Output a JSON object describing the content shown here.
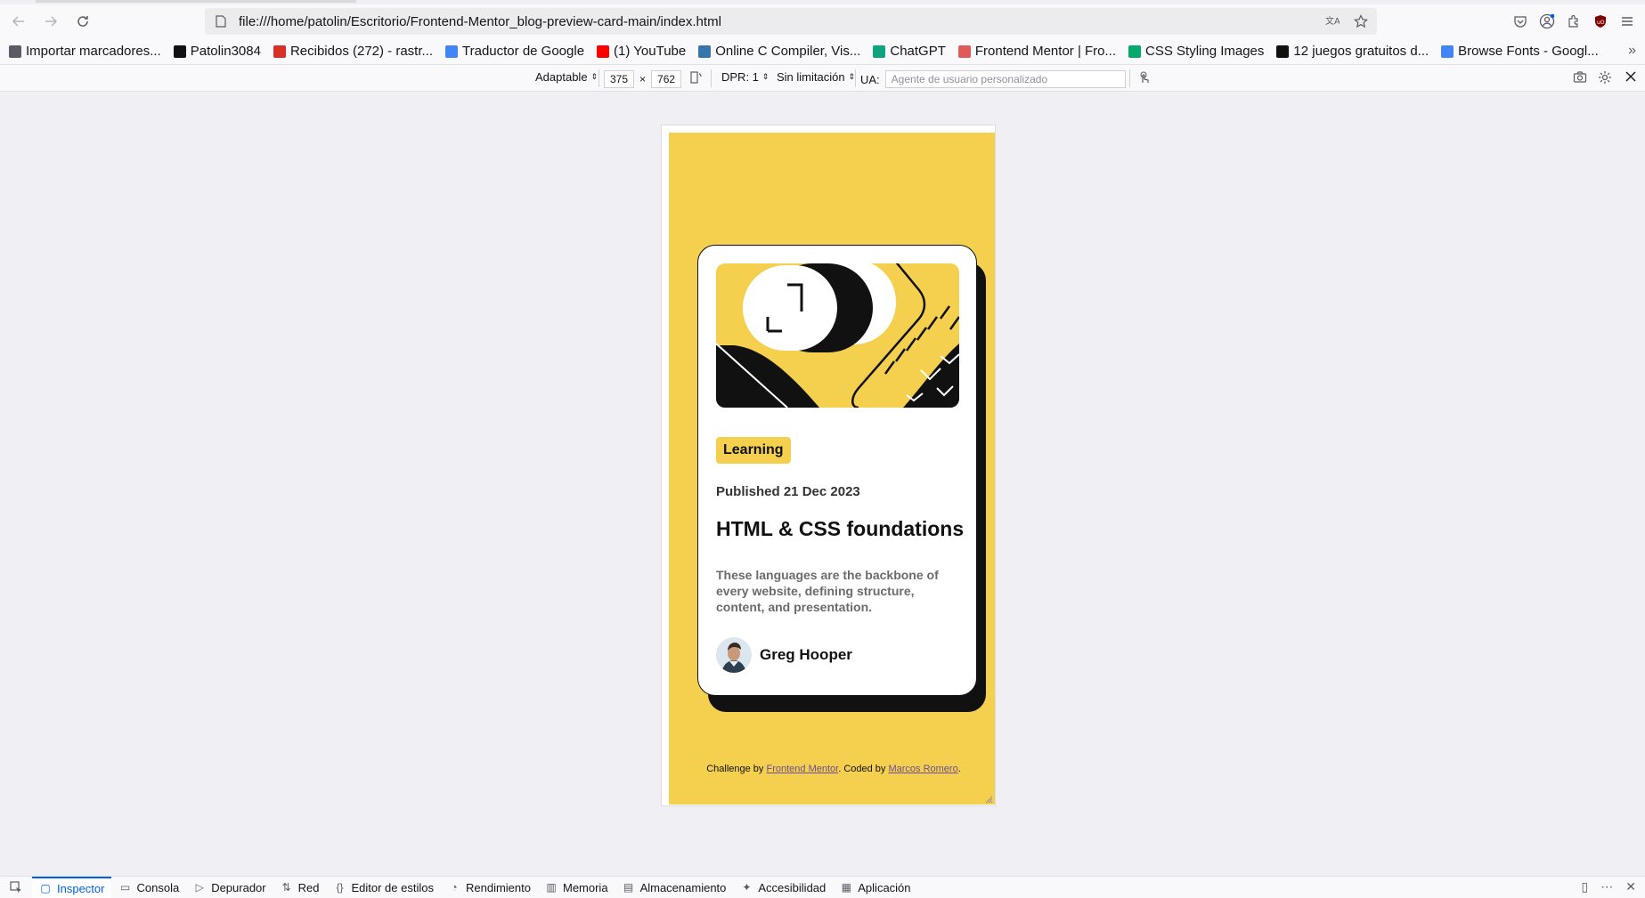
{
  "browser": {
    "url": "file:///home/patolin/Escritorio/Frontend-Mentor_blog-preview-card-main/index.html"
  },
  "bookmarks": [
    {
      "label": "Importar marcadores...",
      "icon": "import-icon",
      "color": "#5b5b66"
    },
    {
      "label": "Patolin3084",
      "icon": "github-icon",
      "color": "#111111"
    },
    {
      "label": "Recibidos (272) - rastr...",
      "icon": "gmail-icon",
      "color": "#d93025"
    },
    {
      "label": "Traductor de Google",
      "icon": "translate-icon",
      "color": "#4285f4"
    },
    {
      "label": "(1) YouTube",
      "icon": "youtube-icon",
      "color": "#ff0000"
    },
    {
      "label": "Online C Compiler, Vis...",
      "icon": "python-icon",
      "color": "#3776ab"
    },
    {
      "label": "ChatGPT",
      "icon": "chatgpt-icon",
      "color": "#10a37f"
    },
    {
      "label": "Frontend Mentor | Fro...",
      "icon": "frontend-mentor-icon",
      "color": "#e05a5a"
    },
    {
      "label": "CSS Styling Images",
      "icon": "w3schools-icon",
      "color": "#04aa6d"
    },
    {
      "label": "12 juegos gratuitos d...",
      "icon": "game-icon",
      "color": "#111111"
    },
    {
      "label": "Browse Fonts - Googl...",
      "icon": "google-fonts-icon",
      "color": "#4285f4"
    }
  ],
  "rdm": {
    "device": "Adaptable",
    "width": "375",
    "times": "×",
    "height": "762",
    "dpr": "DPR: 1",
    "throttle": "Sin limitación",
    "ua_label": "UA:",
    "ua_placeholder": "Agente de usuario personalizado"
  },
  "card": {
    "tag": "Learning",
    "published": "Published 21 Dec 2023",
    "title": "HTML & CSS foundations",
    "description": "These languages are the backbone of every website, defining structure, content, and presentation.",
    "author": "Greg Hooper"
  },
  "attribution": {
    "prefix": "Challenge by ",
    "fm_link": "Frontend Mentor",
    "middle": ". Coded by ",
    "author_link": "Marcos Romero",
    "suffix": "."
  },
  "devtools": {
    "tabs": [
      {
        "label": "Inspector",
        "icon": "inspector-icon",
        "active": true
      },
      {
        "label": "Consola",
        "icon": "console-icon"
      },
      {
        "label": "Depurador",
        "icon": "debugger-icon"
      },
      {
        "label": "Red",
        "icon": "network-icon"
      },
      {
        "label": "Editor de estilos",
        "icon": "style-editor-icon"
      },
      {
        "label": "Rendimiento",
        "icon": "performance-icon"
      },
      {
        "label": "Memoria",
        "icon": "memory-icon"
      },
      {
        "label": "Almacenamiento",
        "icon": "storage-icon"
      },
      {
        "label": "Accesibilidad",
        "icon": "accessibility-icon"
      },
      {
        "label": "Aplicación",
        "icon": "application-icon"
      }
    ]
  },
  "colors": {
    "page_bg": "#f4d04e",
    "card_bg": "#ffffff",
    "text": "#111111",
    "accent": "#0060df"
  }
}
